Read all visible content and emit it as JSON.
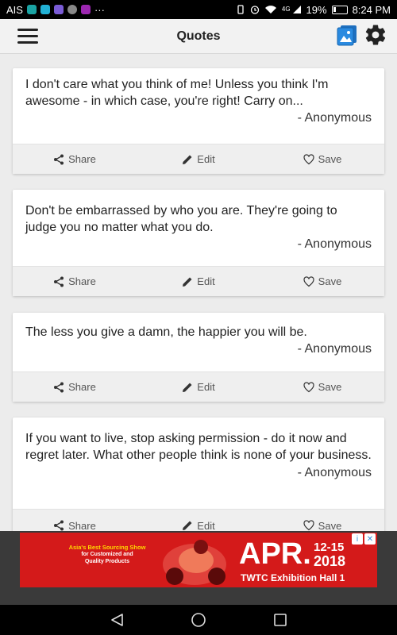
{
  "status_bar": {
    "carrier": "AIS",
    "overflow": "···",
    "network": "4G",
    "battery": "19%",
    "time": "8:24 PM",
    "app_icon_colors": [
      "#1aa3a3",
      "#21b0d4",
      "#7b5cd6",
      "#888888",
      "#9c27b0"
    ]
  },
  "app_bar": {
    "title": "Quotes",
    "menu_icon": "hamburger-menu-icon",
    "gallery_icon": "gallery-icon",
    "settings_icon": "gear-icon"
  },
  "actions": {
    "share_label": "Share",
    "edit_label": "Edit",
    "save_label": "Save"
  },
  "quotes": [
    {
      "text": "I don't care what you think of me! Unless you think I'm awesome - in which case, you're right! Carry on...",
      "author": "- Anonymous"
    },
    {
      "text": "Don't be embarrassed by who you are. They're going to judge you no matter what you do.",
      "author": "- Anonymous"
    },
    {
      "text": "The less you give a damn, the happier you will be.",
      "author": "- Anonymous"
    },
    {
      "text": "If you want to live, stop asking permission - do it now and regret later. What other people think is none of your business.",
      "author": "- Anonymous"
    }
  ],
  "ad": {
    "tagline_1": "Asia's Best Sourcing Show",
    "tagline_2": "for Customized and",
    "tagline_3": "Quality Products",
    "month": "APR.",
    "dates": "12-15",
    "year": "2018",
    "venue": "TWTC Exhibition Hall 1",
    "info_icon": "ad-info-icon",
    "close_icon": "ad-close-icon",
    "color": "#d41a1a"
  },
  "nav_bar": {
    "back_icon": "back-triangle-icon",
    "home_icon": "home-circle-icon",
    "recents_icon": "recents-square-icon"
  }
}
